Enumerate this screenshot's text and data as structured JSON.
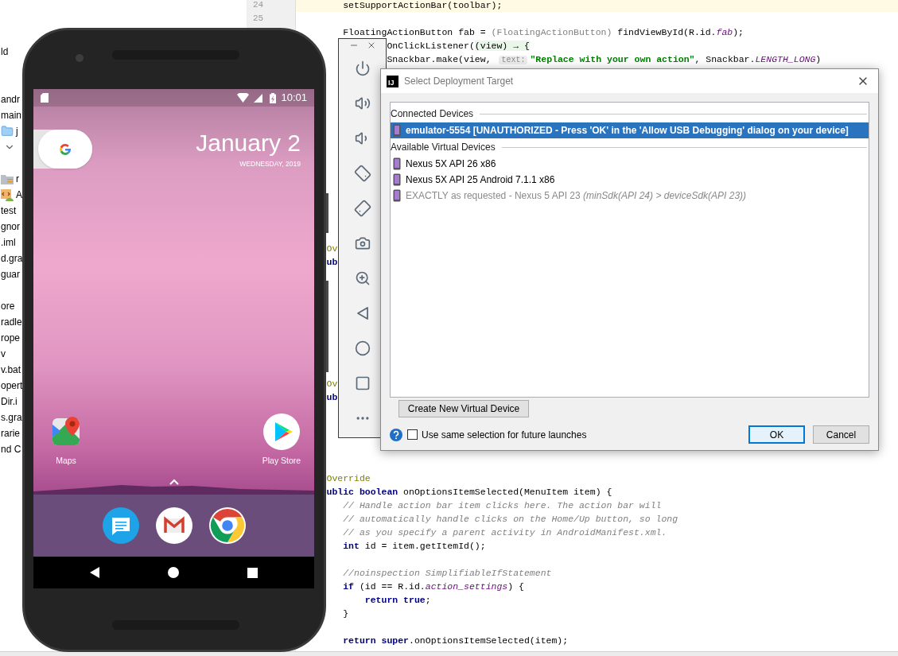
{
  "project_tree": {
    "items": [
      {
        "kind": "text",
        "label": "ld"
      },
      {
        "kind": "spacer"
      },
      {
        "kind": "spacer"
      },
      {
        "kind": "text",
        "label": "andr"
      },
      {
        "kind": "text",
        "label": "main"
      },
      {
        "kind": "folder",
        "label": "j"
      },
      {
        "kind": "expander"
      },
      {
        "kind": "spacer"
      },
      {
        "kind": "res_folder",
        "label": "r"
      },
      {
        "kind": "manifest",
        "label": "A"
      },
      {
        "kind": "text",
        "label": "test"
      },
      {
        "kind": "text",
        "label": "gnor"
      },
      {
        "kind": "text",
        "label": ".iml"
      },
      {
        "kind": "text",
        "label": "d.gra"
      },
      {
        "kind": "text",
        "label": "guar"
      },
      {
        "kind": "spacer"
      },
      {
        "kind": "text",
        "label": "ore"
      },
      {
        "kind": "text",
        "label": "radle"
      },
      {
        "kind": "text",
        "label": "rope"
      },
      {
        "kind": "text",
        "label": "v"
      },
      {
        "kind": "text",
        "label": "v.bat"
      },
      {
        "kind": "text",
        "label": "opert"
      },
      {
        "kind": "text",
        "label": "Dir.i"
      },
      {
        "kind": "text",
        "label": "s.gra"
      },
      {
        "kind": "text",
        "label": "rarie"
      },
      {
        "kind": "text",
        "label": "nd C"
      }
    ]
  },
  "editor": {
    "line_numbers": [
      "24",
      "25"
    ],
    "lines": [
      {
        "highlighted": true,
        "tokens": [
          {
            "kind": "plain",
            "text": "        setSupportActionBar(toolbar);"
          }
        ]
      },
      {
        "highlighted": false
      },
      {
        "highlighted": false,
        "tokens": [
          {
            "kind": "plain",
            "text": "        FloatingActionButton fab = "
          },
          {
            "kind": "muted",
            "text": "(FloatingActionButton)"
          },
          {
            "kind": "plain",
            "text": " findViewById(R.id."
          },
          {
            "kind": "field",
            "text": "fab"
          },
          {
            "kind": "plain",
            "text": ");"
          }
        ]
      },
      {
        "highlighted": false,
        "tokens": [
          {
            "kind": "plain",
            "text": "                OnClickListener("
          },
          {
            "kind": "lambda",
            "text": "(view) → {"
          }
        ]
      },
      {
        "highlighted": false,
        "tokens": [
          {
            "kind": "plain",
            "text": "                Snackbar.make(view, "
          },
          {
            "kind": "hint",
            "text": "text:"
          },
          {
            "kind": "string",
            "text": "\"Replace with your own action\""
          },
          {
            "kind": "plain",
            "text": ", Snackbar."
          },
          {
            "kind": "field",
            "text": "LENGTH_LONG"
          },
          {
            "kind": "plain",
            "text": ")"
          }
        ]
      },
      {
        "highlighted": false
      },
      {
        "highlighted": false
      },
      {
        "highlighted": false
      },
      {
        "highlighted": false
      },
      {
        "highlighted": false
      },
      {
        "highlighted": false
      },
      {
        "highlighted": false
      },
      {
        "highlighted": false
      },
      {
        "highlighted": false
      },
      {
        "highlighted": false
      },
      {
        "highlighted": false
      },
      {
        "highlighted": false
      },
      {
        "highlighted": false
      },
      {
        "highlighted": false,
        "tokens": [
          {
            "kind": "annotation",
            "text": "     Ov"
          }
        ]
      },
      {
        "highlighted": false,
        "tokens": [
          {
            "kind": "keyword",
            "text": "     ub"
          }
        ]
      },
      {
        "highlighted": false
      },
      {
        "highlighted": false
      },
      {
        "highlighted": false
      },
      {
        "highlighted": false
      },
      {
        "highlighted": false
      },
      {
        "highlighted": false
      },
      {
        "highlighted": false
      },
      {
        "highlighted": false
      },
      {
        "highlighted": false,
        "tokens": [
          {
            "kind": "annotation",
            "text": "     Ov"
          }
        ]
      },
      {
        "highlighted": false,
        "tokens": [
          {
            "kind": "keyword",
            "text": "     ub"
          }
        ]
      },
      {
        "highlighted": false
      },
      {
        "highlighted": false
      },
      {
        "highlighted": false
      },
      {
        "highlighted": false
      },
      {
        "highlighted": false
      },
      {
        "highlighted": false,
        "tokens": [
          {
            "kind": "annotation",
            "text": "     Override"
          }
        ]
      },
      {
        "highlighted": false,
        "tokens": [
          {
            "kind": "keyword",
            "text": "     ublic boolean"
          },
          {
            "kind": "plain",
            "text": " onOptionsItemSelected(MenuItem item) {"
          }
        ]
      },
      {
        "highlighted": false,
        "tokens": [
          {
            "kind": "comment",
            "text": "        // Handle action bar item clicks here. The action bar will"
          }
        ]
      },
      {
        "highlighted": false,
        "tokens": [
          {
            "kind": "comment",
            "text": "        // automatically handle clicks on the Home/Up button, so long"
          }
        ]
      },
      {
        "highlighted": false,
        "tokens": [
          {
            "kind": "comment",
            "text": "        // as you specify a parent activity in AndroidManifest.xml."
          }
        ]
      },
      {
        "highlighted": false,
        "tokens": [
          {
            "kind": "keyword",
            "text": "        int"
          },
          {
            "kind": "plain",
            "text": " id = item.getItemId();"
          }
        ]
      },
      {
        "highlighted": false
      },
      {
        "highlighted": false,
        "tokens": [
          {
            "kind": "comment",
            "text": "        //noinspection SimplifiableIfStatement"
          }
        ]
      },
      {
        "highlighted": false,
        "tokens": [
          {
            "kind": "keyword",
            "text": "        if"
          },
          {
            "kind": "plain",
            "text": " (id == R.id."
          },
          {
            "kind": "field",
            "text": "action_settings"
          },
          {
            "kind": "plain",
            "text": ") {"
          }
        ]
      },
      {
        "highlighted": false,
        "tokens": [
          {
            "kind": "keyword",
            "text": "            return true"
          },
          {
            "kind": "plain",
            "text": ";"
          }
        ]
      },
      {
        "highlighted": false,
        "tokens": [
          {
            "kind": "plain",
            "text": "        }"
          }
        ]
      },
      {
        "highlighted": false
      },
      {
        "highlighted": false,
        "tokens": [
          {
            "kind": "keyword",
            "text": "        return super"
          },
          {
            "kind": "plain",
            "text": ".onOptionsItemSelected(item);"
          }
        ]
      }
    ]
  },
  "emulator": {
    "status_bar": {
      "time": "10:01"
    },
    "date": "January 2",
    "weekday": "WEDNESDAY, 2019",
    "home_apps": [
      {
        "kind": "maps",
        "label": "Maps"
      },
      {
        "kind": "play_store",
        "label": "Play Store"
      }
    ],
    "dock_apps": [
      {
        "kind": "messages"
      },
      {
        "kind": "gmail"
      },
      {
        "kind": "chrome"
      }
    ]
  },
  "emulator_toolbar": {
    "buttons": [
      {
        "kind": "power"
      },
      {
        "kind": "volume_up"
      },
      {
        "kind": "volume_down"
      },
      {
        "kind": "rotate_left"
      },
      {
        "kind": "rotate_right"
      },
      {
        "kind": "screenshot"
      },
      {
        "kind": "zoom"
      },
      {
        "kind": "back"
      },
      {
        "kind": "home"
      },
      {
        "kind": "overview"
      },
      {
        "kind": "more"
      }
    ]
  },
  "dialog": {
    "logo": "IJ",
    "title": "Select Deployment Target",
    "sections": [
      {
        "heading": "Connected Devices",
        "devices": [
          {
            "label": "emulator-5554 [UNAUTHORIZED - Press 'OK' in the 'Allow USB Debugging' dialog on your device]",
            "selected": true,
            "disabled": false
          }
        ]
      },
      {
        "heading": "Available Virtual Devices",
        "devices": [
          {
            "label": "Nexus 5X API 26 x86",
            "selected": false,
            "disabled": false
          },
          {
            "label": "Nexus 5X API 25 Android 7.1.1 x86",
            "selected": false,
            "disabled": false
          },
          {
            "label": "EXACTLY as requested - Nexus 5 API 23 *(minSdk(API 24) > deviceSdk(API 23))*",
            "selected": false,
            "disabled": true
          }
        ]
      }
    ],
    "create_button": "Create New Virtual Device",
    "remember": {
      "label": "Use same selection for future launches",
      "checked": false
    },
    "ok_button": "OK",
    "cancel_button": "Cancel"
  }
}
